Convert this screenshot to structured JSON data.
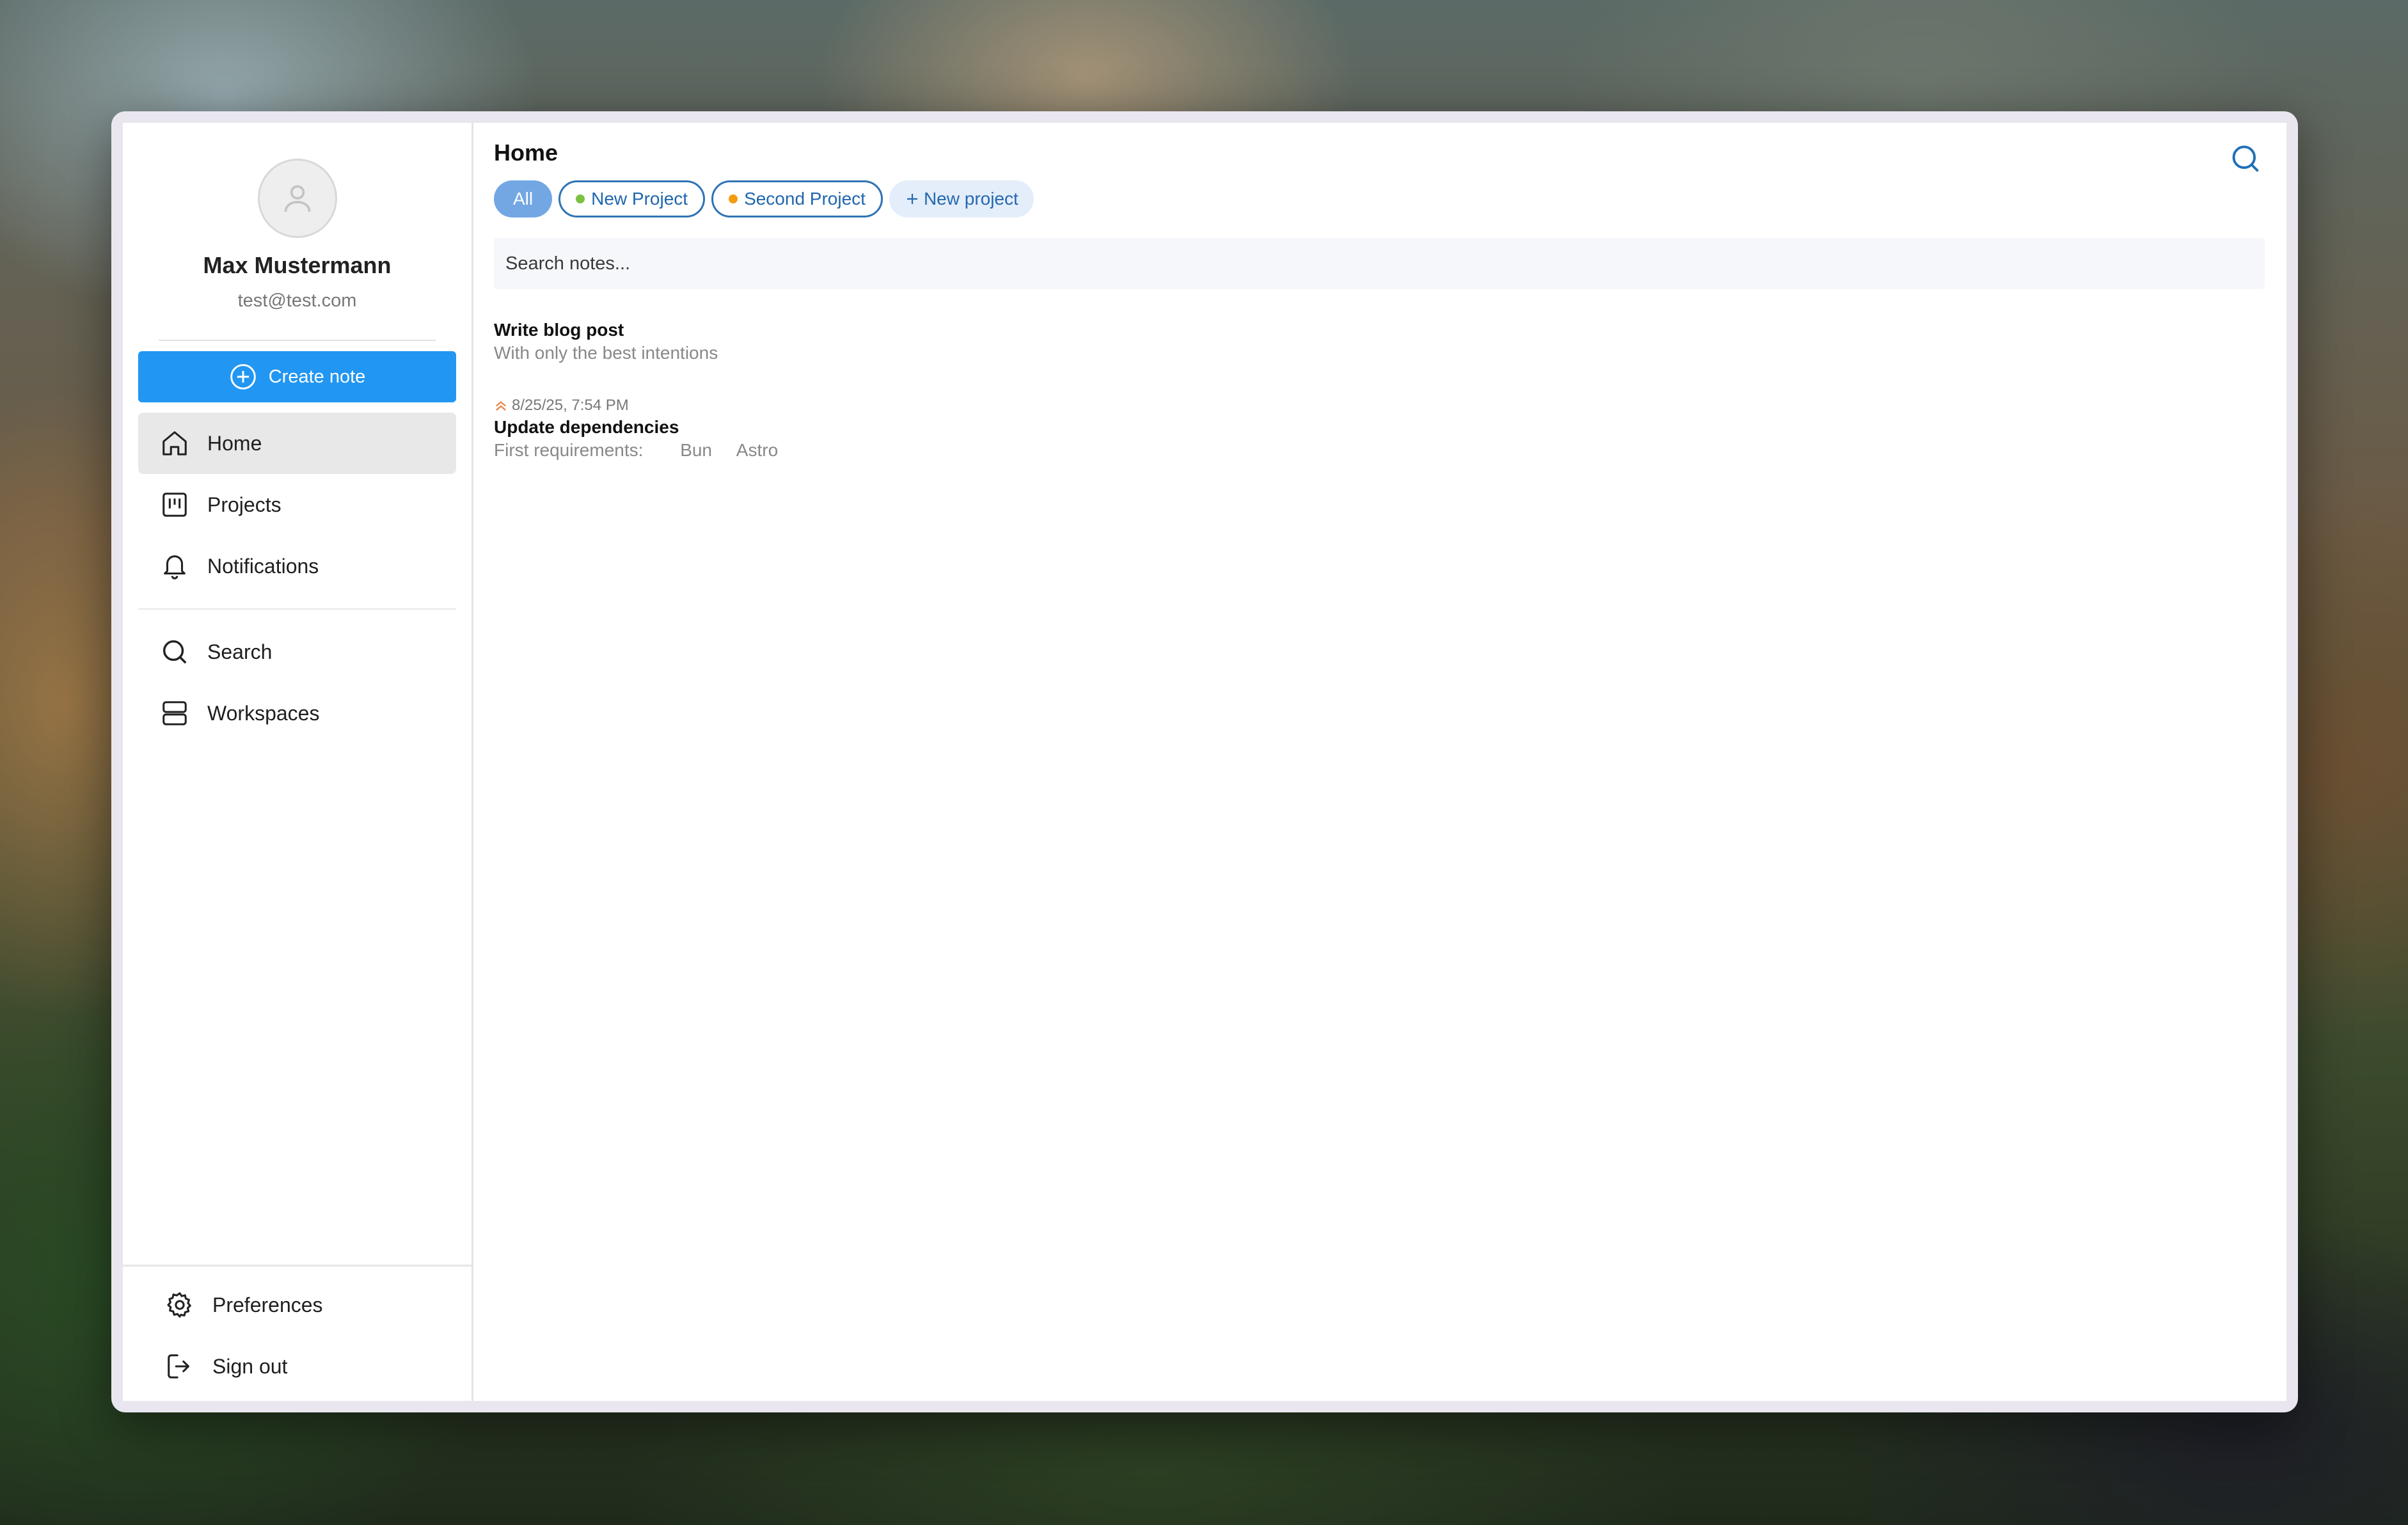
{
  "profile": {
    "name": "Max Mustermann",
    "email": "test@test.com"
  },
  "sidebar": {
    "create_label": "Create note",
    "items": [
      {
        "label": "Home",
        "icon": "home-icon",
        "active": true
      },
      {
        "label": "Projects",
        "icon": "projects-icon"
      },
      {
        "label": "Notifications",
        "icon": "bell-icon"
      },
      {
        "label": "Search",
        "icon": "search-icon"
      },
      {
        "label": "Workspaces",
        "icon": "workspaces-icon"
      }
    ],
    "footer": [
      {
        "label": "Preferences",
        "icon": "gear-icon"
      },
      {
        "label": "Sign out",
        "icon": "sign-out-icon"
      }
    ]
  },
  "main": {
    "title": "Home",
    "tabs": [
      {
        "label": "All",
        "active": true
      },
      {
        "label": "New Project",
        "dot_color": "#7cc242"
      },
      {
        "label": "Second Project",
        "dot_color": "#f39c12"
      },
      {
        "label": "New project",
        "icon": "plus-icon"
      }
    ],
    "search_placeholder": "Search notes...",
    "notes": [
      {
        "title": "Write blog post",
        "subtitle": "With only the best intentions"
      },
      {
        "meta": "8/25/25, 7:54 PM",
        "meta_icon": "priority-high-icon",
        "title": "Update dependencies",
        "subtitle": "First requirements:",
        "tags": [
          "Bun",
          "Astro"
        ]
      }
    ]
  },
  "colors": {
    "accent": "#2196f3",
    "chip_all": "#72a7e3",
    "chip_outline": "#2f73b5",
    "priority": "#e8894a"
  }
}
